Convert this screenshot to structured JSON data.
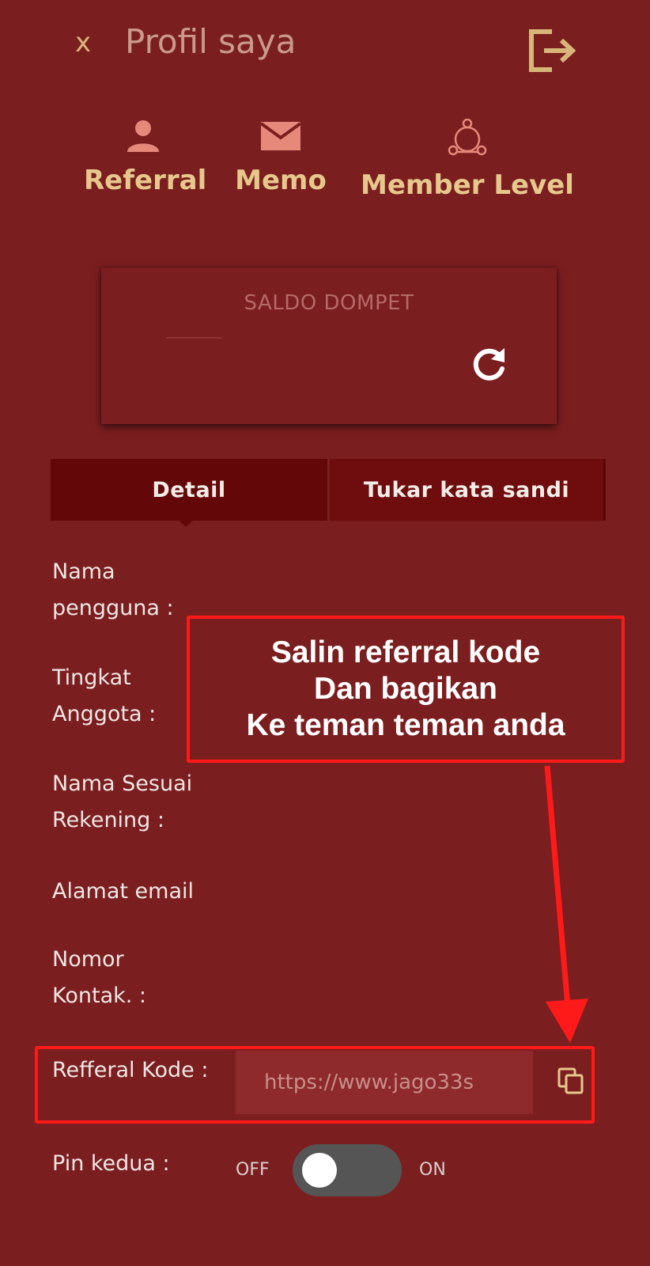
{
  "header": {
    "close_label": "x",
    "title": "Profil saya",
    "logout_icon": "logout-icon"
  },
  "quick_nav": [
    {
      "label": "Referral",
      "icon": "person-icon"
    },
    {
      "label": "Memo",
      "icon": "envelope-icon"
    },
    {
      "label": "Member Level",
      "icon": "member-level-icon"
    }
  ],
  "wallet": {
    "label": "SALDO DOMPET",
    "refresh_icon": "refresh-icon"
  },
  "tabs": [
    {
      "label": "Detail",
      "active": true
    },
    {
      "label": "Tukar kata sandi",
      "active": false
    }
  ],
  "fields": {
    "username_line1": "Nama",
    "username_line2": "pengguna :",
    "level_line1": "Tingkat",
    "level_line2": "Anggota :",
    "account_name_line1": "Nama Sesuai",
    "account_name_line2": "Rekening :",
    "email": "Alamat email",
    "phone_line1": "Nomor",
    "phone_line2": "Kontak. :",
    "referral_label": "Refferal Kode :",
    "referral_value": "https://www.jago33s",
    "pin_label": "Pin kedua :"
  },
  "toggle": {
    "off_label": "OFF",
    "on_label": "ON",
    "state": "off"
  },
  "callout": {
    "line1": "Salin referral kode",
    "line2": "Dan bagikan",
    "line3": "Ke teman teman anda"
  },
  "colors": {
    "background": "#7b1e20",
    "accent_gold": "#e6c88c",
    "active_tab": "#630709",
    "annotation_red": "#ff1a1a"
  }
}
